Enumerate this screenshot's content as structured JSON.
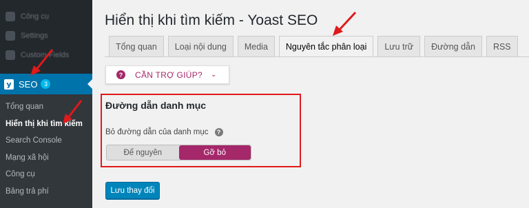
{
  "sidebar": {
    "blurred_items": [
      "Công cụ",
      "Settings",
      "Custom Fields"
    ],
    "seo": {
      "label": "SEO",
      "badge": "3"
    },
    "submenu": [
      {
        "label": "Tổng quan"
      },
      {
        "label": "Hiển thị khi tìm kiếm"
      },
      {
        "label": "Search Console"
      },
      {
        "label": "Mạng xã hội"
      },
      {
        "label": "Công cụ"
      },
      {
        "label": "Bảng trả phí"
      }
    ]
  },
  "page": {
    "title": "Hiển thị khi tìm kiếm - Yoast SEO"
  },
  "tabs": [
    {
      "label": "Tổng quan"
    },
    {
      "label": "Loại nội dung"
    },
    {
      "label": "Media"
    },
    {
      "label": "Nguyên tắc phân loại"
    },
    {
      "label": "Lưu trữ"
    },
    {
      "label": "Đường dẫn"
    },
    {
      "label": "RSS"
    }
  ],
  "active_tab": "Nguyên tắc phân loại",
  "help": {
    "icon": "?",
    "label": "CẦN TRỢ GIÚP?",
    "chevron": "⌄"
  },
  "section": {
    "title": "Đường dẫn danh mục",
    "field_label": "Bỏ đường dẫn của danh mục",
    "help_icon": "?",
    "toggle": {
      "options": [
        "Để nguyên",
        "Gỡ bỏ"
      ],
      "selected": "Gỡ bỏ"
    }
  },
  "save_button": "Lưu thay đổi",
  "colors": {
    "sidebar_bg": "#23282d",
    "submenu_bg": "#32373c",
    "wp_blue": "#0073aa",
    "yoast_purple": "#a4286a",
    "annotation_red": "#e0191b",
    "button_blue": "#0085ba"
  }
}
